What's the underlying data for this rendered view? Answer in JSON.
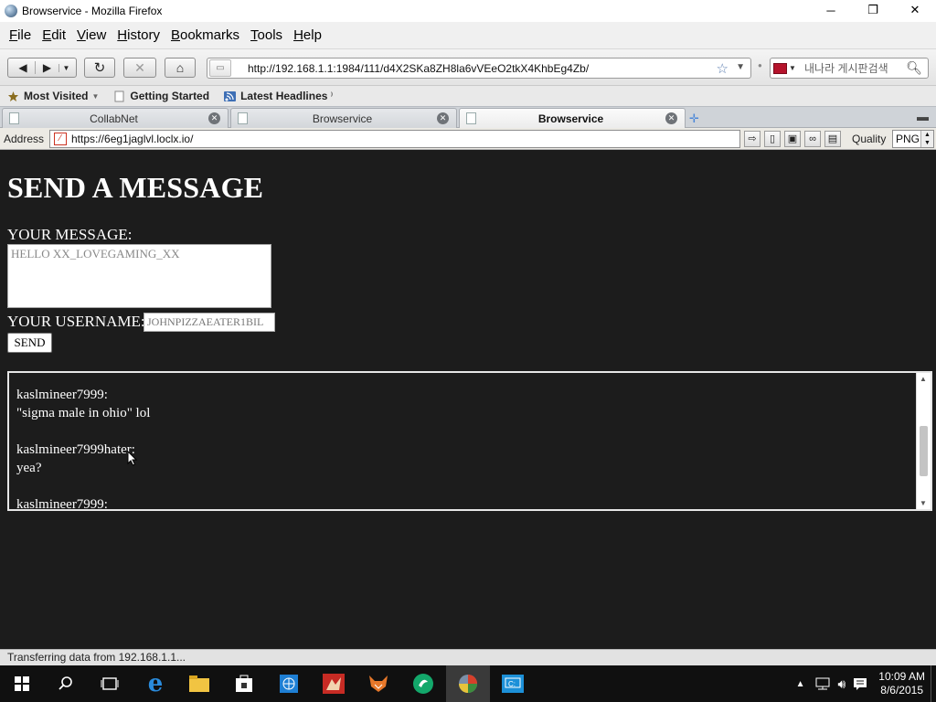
{
  "window": {
    "title": "Browservice - Mozilla Firefox",
    "controls": {
      "minimize": "─",
      "maximize": "❐",
      "close": "✕"
    }
  },
  "menu": {
    "items": [
      {
        "label": "File",
        "u": "F",
        "rest": "ile"
      },
      {
        "label": "Edit",
        "u": "E",
        "rest": "dit"
      },
      {
        "label": "View",
        "u": "V",
        "rest": "iew"
      },
      {
        "label": "History",
        "u": "H",
        "rest": "istory"
      },
      {
        "label": "Bookmarks",
        "u": "B",
        "rest": "ookmarks"
      },
      {
        "label": "Tools",
        "u": "T",
        "rest": "ools"
      },
      {
        "label": "Help",
        "u": "H",
        "rest": "elp"
      }
    ]
  },
  "navbar": {
    "url": "http://192.168.1.1:1984/111/d4X2SKa8ZH8la6vVEeO2tkX4KhbEg4Zb/",
    "search_placeholder": "내나라 게시판검색"
  },
  "bookmarks": {
    "items": [
      {
        "label": "Most Visited",
        "icon": "star-folder-icon"
      },
      {
        "label": "Getting Started",
        "icon": "page-icon"
      },
      {
        "label": "Latest Headlines",
        "icon": "rss-icon"
      }
    ]
  },
  "tabs": [
    {
      "label": "CollabNet",
      "active": false
    },
    {
      "label": "Browservice",
      "active": false
    },
    {
      "label": "Browservice",
      "active": true
    }
  ],
  "addressbar": {
    "label": "Address",
    "url": "https://6eg1jaglvl.loclx.io/",
    "quality_label": "Quality",
    "quality_value": "PNG"
  },
  "page": {
    "heading": "SEND A MESSAGE",
    "message_label": "YOUR MESSAGE:",
    "message_value": "HELLO XX_LOVEGAMING_XX",
    "username_label": "YOUR USERNAME:",
    "username_value": "JOHNPIZZAEATER1BIL",
    "send_label": "SEND",
    "chat_lines": [
      "kaslmineer7999:",
      "\"sigma male in ohio\" lol",
      "",
      "kaslmineer7999hater:",
      "yea?",
      "",
      "kaslmineer7999:"
    ]
  },
  "status": {
    "text": "Transferring data from 192.168.1.1..."
  },
  "taskbar": {
    "time": "10:09 AM",
    "date": "8/6/2015"
  }
}
